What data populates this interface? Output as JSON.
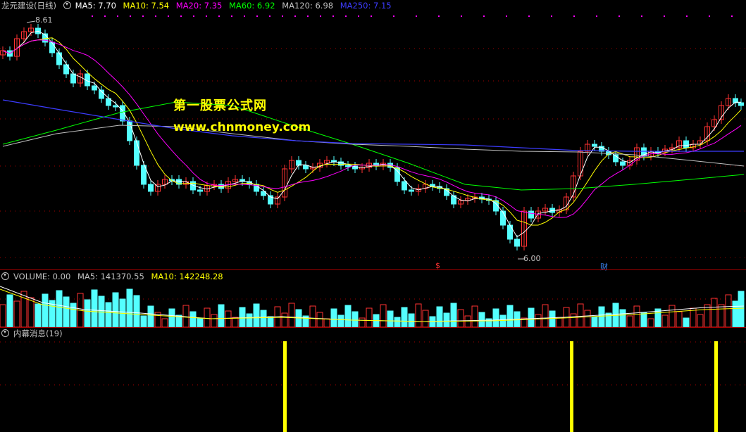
{
  "price_header": {
    "title": "龙元建设(日线)",
    "ma5": "MA5: 7.70",
    "ma10": "MA10: 7.54",
    "ma20": "MA20: 7.35",
    "ma60": "MA60: 6.92",
    "ma120": "MA120: 6.98",
    "ma250": "MA250: 7.15"
  },
  "price_labels": {
    "high": "8.61",
    "low": "6.00",
    "marker_dollar": "$",
    "marker_cai": "财"
  },
  "watermark": {
    "line1": "第一股票公式网",
    "line2": "www.chnmoney.com"
  },
  "volume_header": {
    "volume": "VOLUME: 0.00",
    "ma5": "MA5: 141370.55",
    "ma10": "MA10: 142248.28"
  },
  "indicator_header": {
    "title": "内幕消息(19)"
  },
  "colors": {
    "background": "#000000",
    "up_candle": "#ff3232",
    "down_candle": "#54ffff",
    "ma5": "#ffffff",
    "ma10": "#ffff00",
    "ma20": "#ff00ff",
    "ma60": "#00ff00",
    "ma120": "#c0c0c0",
    "ma250": "#3c3cff",
    "grid": "#a00000",
    "signal": "#ffff00"
  },
  "chart_data": {
    "type": "candlestick",
    "price_range": [
      6.0,
      8.61
    ],
    "ma_last": {
      "MA5": 7.7,
      "MA10": 7.54,
      "MA20": 7.35,
      "MA60": 6.92,
      "MA120": 6.98,
      "MA250": 7.15
    },
    "signal_count": 3
  }
}
